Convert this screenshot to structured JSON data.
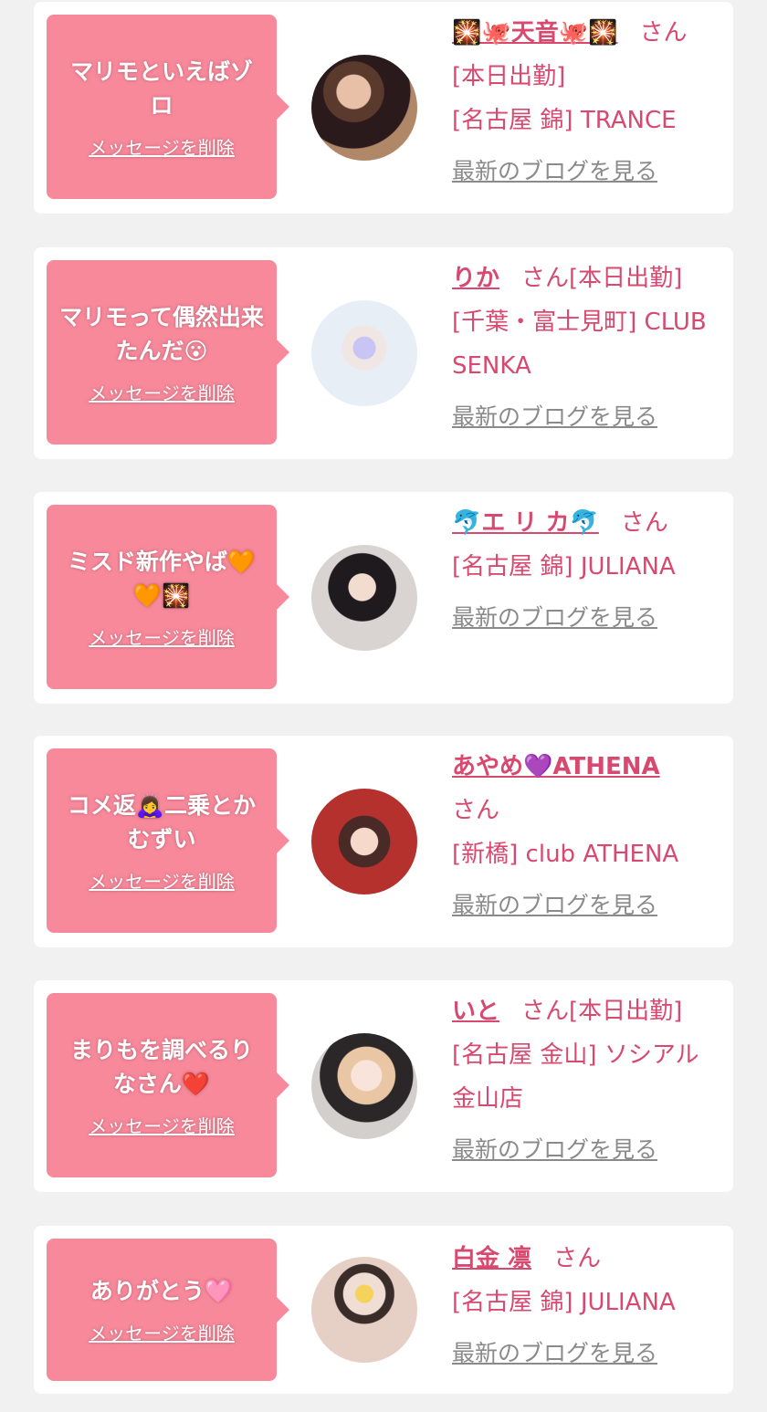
{
  "delete_label": "メッセージを削除",
  "blog_label": "最新のブログを見る",
  "san_label": "さん",
  "colors": {
    "accent": "#d84970",
    "bubble": "#f7899b",
    "background": "#f1f1f1"
  },
  "items": [
    {
      "message": "マリモといえばゾロ",
      "name": "🎇🐙天音🐙🎇",
      "status": "[本日出勤]",
      "shop": "[名古屋 錦] TRANCE"
    },
    {
      "message": "マリモって偶然出来たんだ😮",
      "name": "りか",
      "status": "[本日出勤]",
      "shop": "[千葉・富士見町] CLUB SENKA"
    },
    {
      "message": "ミスド新作やば🧡🧡🎇",
      "name": "🐬エ リ カ🐬",
      "status": "",
      "shop": "[名古屋 錦] JULIANA"
    },
    {
      "message": "コメ返🙇‍♀️二乗とかむずい",
      "name": "あやめ💜ATHENA",
      "status": "",
      "shop": "[新橋] club ATHENA"
    },
    {
      "message": "まりもを調べるりなさん❤️",
      "name": "いと",
      "status": "[本日出勤]",
      "shop": "[名古屋 金山] ソシアル金山店"
    },
    {
      "message": "ありがとう🩷",
      "name": "白金 凛",
      "status": "",
      "shop": "[名古屋 錦] JULIANA"
    }
  ]
}
